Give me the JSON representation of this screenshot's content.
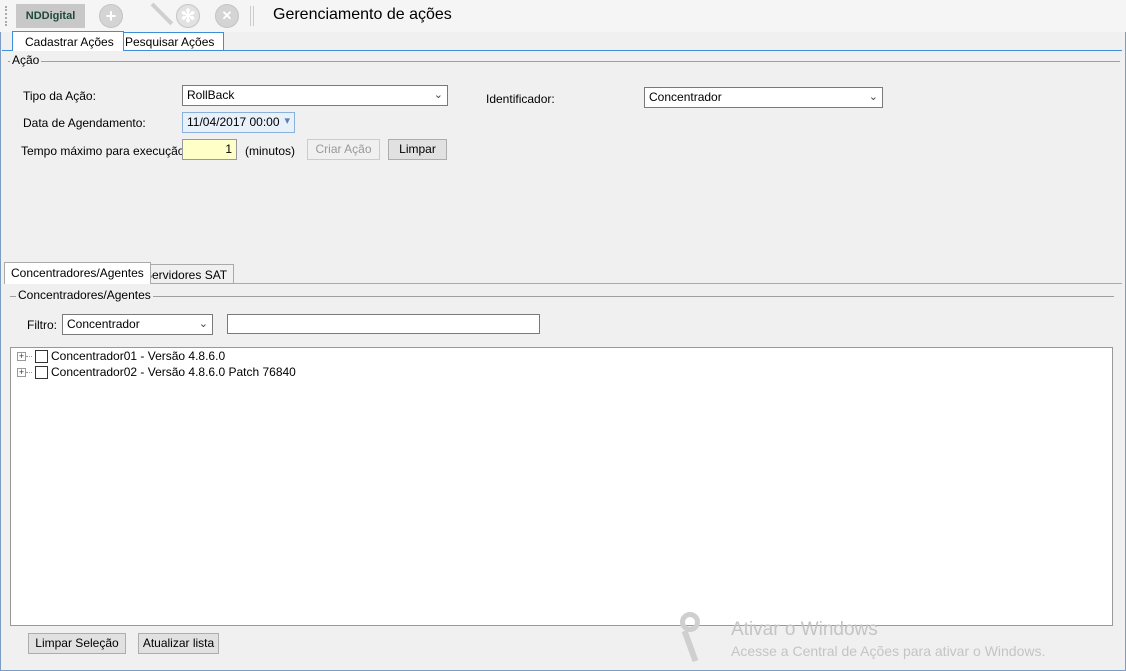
{
  "toolbar": {
    "logo": "NDDigital",
    "title": "Gerenciamento de ações",
    "icons": [
      "add-icon",
      "pencil-icon",
      "gear-icon",
      "close-icon"
    ]
  },
  "tabs": [
    {
      "label": "Cadastrar Ações",
      "active": true
    },
    {
      "label": "Pesquisar Ações",
      "active": false
    }
  ],
  "acao": {
    "legend": "Ação",
    "tipo_label": "Tipo da Ação:",
    "tipo_value": "RollBack",
    "identificador_label": "Identificador:",
    "identificador_value": "Concentrador",
    "data_label": "Data de Agendamento:",
    "data_value": "11/04/2017 00:00",
    "tempo_label": "Tempo máximo para execução:",
    "tempo_value": "1",
    "tempo_unit": "(minutos)",
    "criar_label": "Criar Ação",
    "limpar_label": "Limpar"
  },
  "subtabs": [
    {
      "label": "Concentradores/Agentes",
      "active": true
    },
    {
      "label": "Servidores SAT",
      "active": false
    }
  ],
  "conc": {
    "legend": "Concentradores/Agentes",
    "filtro_label": "Filtro:",
    "filtro_value": "Concentrador",
    "filtro_text": "",
    "items": [
      {
        "label": "Concentrador01  - Versão 4.8.6.0",
        "checked": false
      },
      {
        "label": "Concentrador02  - Versão 4.8.6.0 Patch 76840",
        "checked": false
      }
    ],
    "limpar_selecao": "Limpar Seleção",
    "atualizar": "Atualizar lista"
  },
  "watermark": {
    "line1": "Ativar o Windows",
    "line2": "Acesse a Central de Ações para ativar o Windows."
  }
}
